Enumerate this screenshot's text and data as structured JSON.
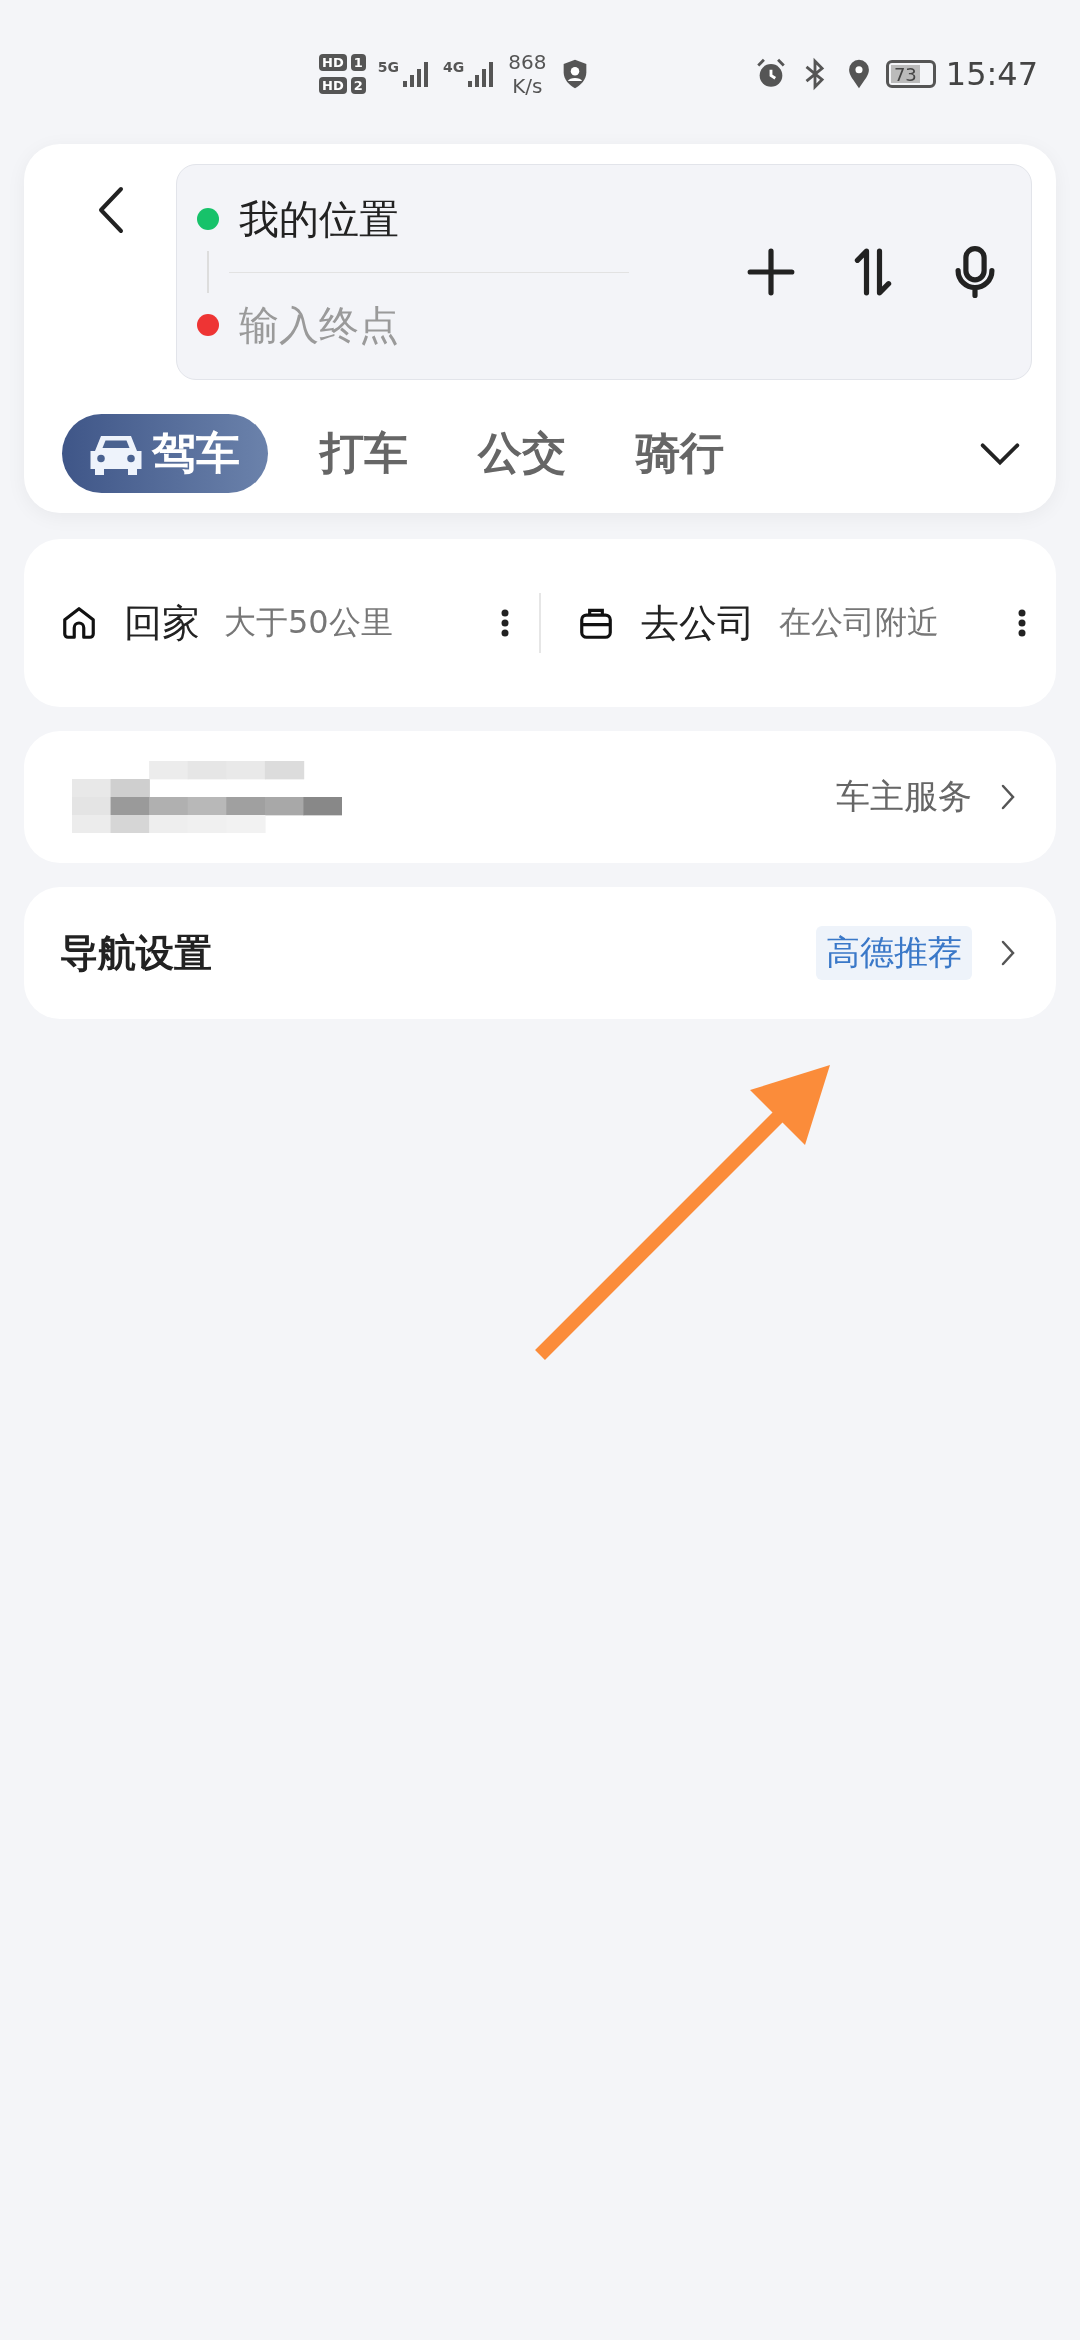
{
  "status_bar": {
    "sims": [
      {
        "label": "HD",
        "slot": "1"
      },
      {
        "label": "HD",
        "slot": "2"
      }
    ],
    "networks": [
      "5G",
      "4G"
    ],
    "speed_value": "868",
    "speed_unit": "K/s",
    "battery": "73",
    "time": "15:47"
  },
  "route": {
    "start": {
      "value": "我的位置"
    },
    "end": {
      "placeholder": "输入终点"
    }
  },
  "modes": [
    {
      "label": "驾车",
      "selected": true
    },
    {
      "label": "打车",
      "selected": false
    },
    {
      "label": "公交",
      "selected": false
    },
    {
      "label": "骑行",
      "selected": false
    }
  ],
  "shortcuts": [
    {
      "kind": "home",
      "label": "回家",
      "detail": "大于50公里"
    },
    {
      "kind": "work",
      "label": "去公司",
      "detail": "在公司附近"
    }
  ],
  "car_service": {
    "link": "车主服务"
  },
  "nav_settings": {
    "title": "导航设置",
    "badge": "高德推荐"
  }
}
